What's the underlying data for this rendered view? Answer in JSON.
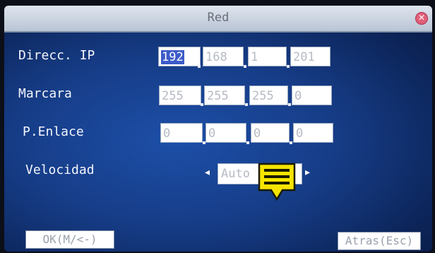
{
  "window": {
    "title": "Red"
  },
  "fields": {
    "ip": {
      "label": "Direcc. IP",
      "octets": [
        "192",
        "168",
        "1",
        "201"
      ]
    },
    "mask": {
      "label": "Marcara",
      "octets": [
        "255",
        "255",
        "255",
        "0"
      ]
    },
    "gateway": {
      "label": "P.Enlace",
      "octets": [
        "0",
        "0",
        "0",
        "0"
      ]
    },
    "speed": {
      "label": "Velocidad",
      "value": "Auto"
    }
  },
  "buttons": {
    "ok": "OK(M/<-)",
    "back": "Atras(Esc)"
  },
  "icons": {
    "close": "close-icon",
    "prev": "arrow-left-icon",
    "next": "arrow-right-icon",
    "cursor": "menu-cursor-icon"
  },
  "colors": {
    "background": "#163c86",
    "titlebar": "#c9d2e0",
    "selection": "#3c5cc8",
    "cursor": "#f5e400"
  }
}
